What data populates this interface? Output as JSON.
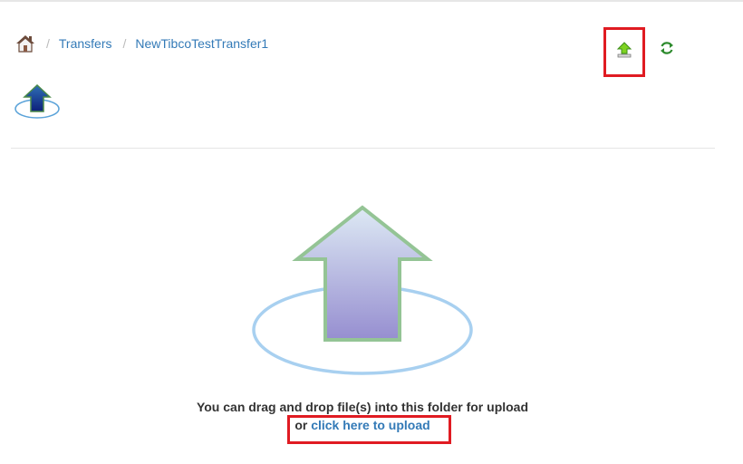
{
  "breadcrumb": {
    "home_icon": "home-icon",
    "separator": "/",
    "items": [
      {
        "label": "Transfers"
      },
      {
        "label": "NewTibcoTestTransfer1"
      }
    ]
  },
  "toolbar": {
    "upload_icon": "upload-icon",
    "refresh_icon": "refresh-icon",
    "highlight_color": "#e01b22"
  },
  "dropzone": {
    "icon": "upload-arrow-icon",
    "message": "You can drag and drop file(s) into this folder for upload",
    "or_text": "or ",
    "link_text": "click here to upload"
  },
  "colors": {
    "link": "#337ab7",
    "text": "#333333",
    "highlight": "#e01b22"
  }
}
